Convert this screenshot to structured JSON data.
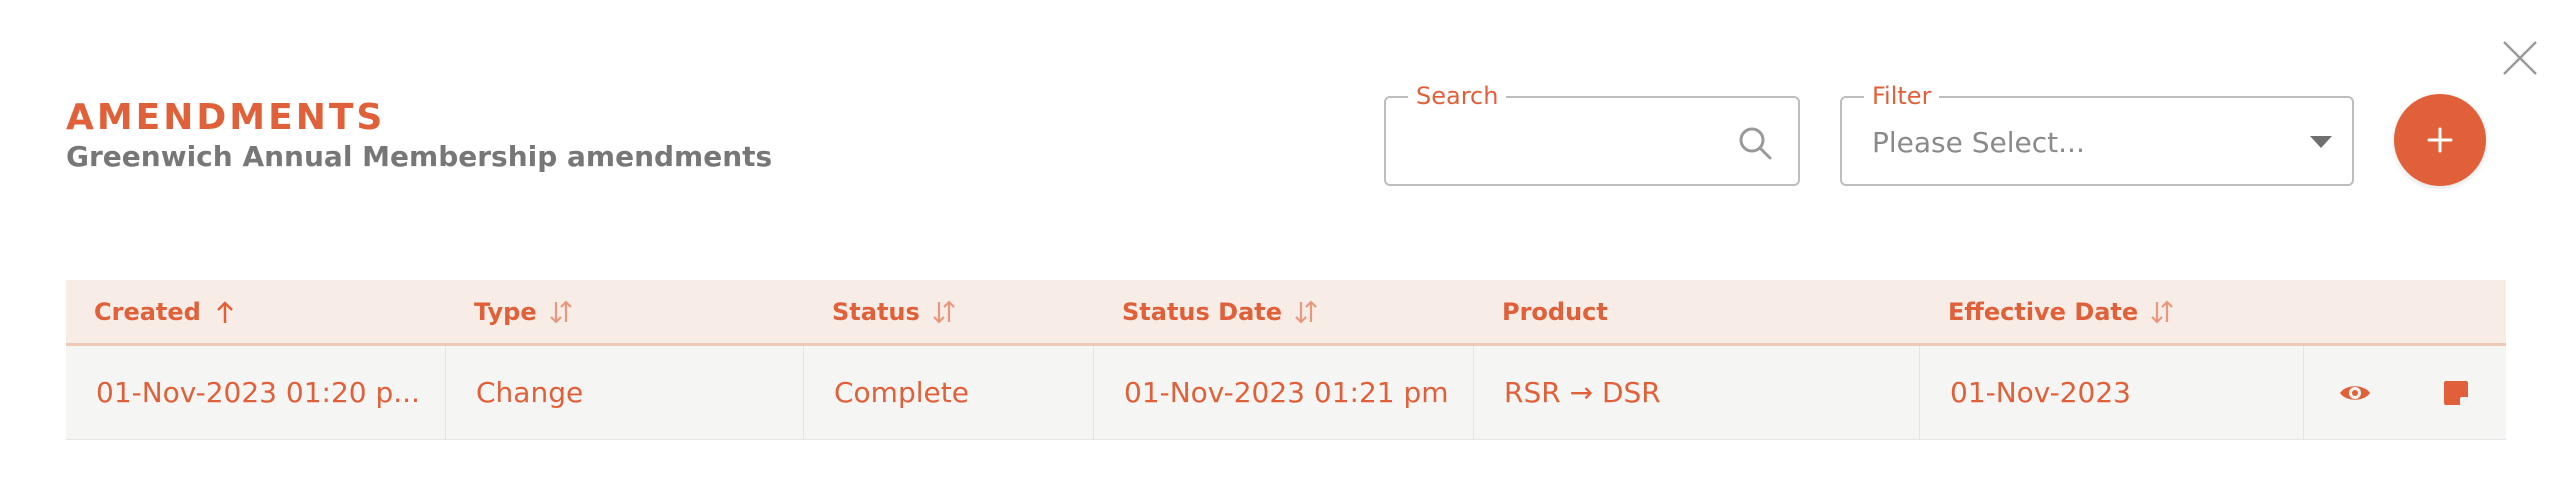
{
  "header": {
    "title": "AMENDMENTS",
    "subtitle": "Greenwich Annual Membership amendments"
  },
  "search": {
    "legend": "Search",
    "value": "",
    "placeholder": ""
  },
  "filter": {
    "legend": "Filter",
    "selected": "Please Select..."
  },
  "add_button": {
    "icon": "plus-icon"
  },
  "close_button": {
    "icon": "close-icon"
  },
  "table": {
    "columns": [
      {
        "label": "Created",
        "sort": "ascending"
      },
      {
        "label": "Type",
        "sort": "sortable"
      },
      {
        "label": "Status",
        "sort": "sortable"
      },
      {
        "label": "Status Date",
        "sort": "sortable"
      },
      {
        "label": "Product",
        "sort": "none"
      },
      {
        "label": "Effective Date",
        "sort": "sortable"
      },
      {
        "label": "",
        "sort": "none"
      }
    ],
    "rows": [
      {
        "created": "01-Nov-2023 01:20 p...",
        "type": "Change",
        "status": "Complete",
        "status_date": "01-Nov-2023 01:21 pm",
        "product": "RSR → DSR",
        "effective_date": "01-Nov-2023",
        "actions": [
          "eye-icon",
          "note-icon"
        ]
      }
    ]
  },
  "colors": {
    "accent": "#e0603a",
    "header_bg": "#f7ece6",
    "row_bg": "#f5f5f4",
    "subtitle": "#777777"
  }
}
